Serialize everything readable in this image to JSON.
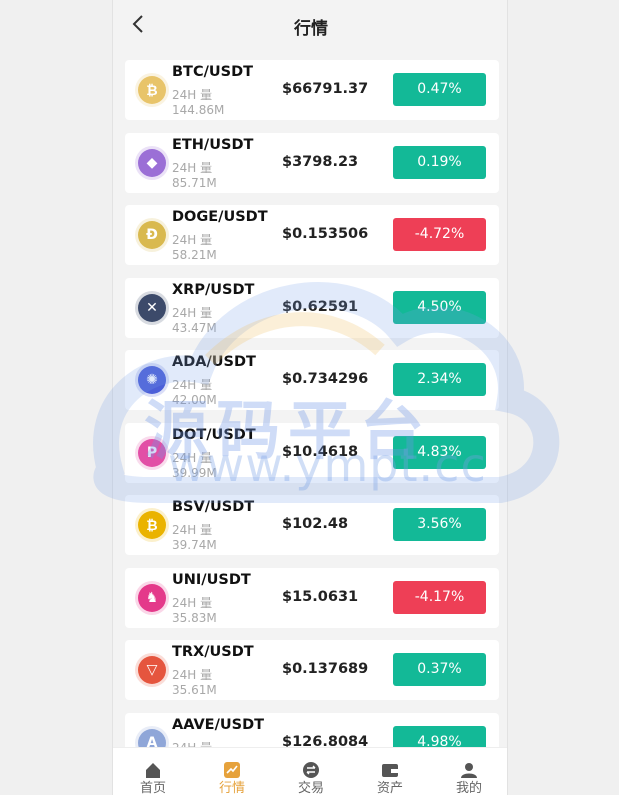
{
  "header": {
    "title": "行情"
  },
  "volume_label": "24H 量",
  "markets": [
    {
      "pair": "BTC/USDT",
      "volume": "144.86M",
      "price": "$66791.37",
      "change": "0.47%",
      "direction": "up",
      "icon": "bitcoin-icon",
      "icon_color": "#e8c46a"
    },
    {
      "pair": "ETH/USDT",
      "volume": "85.71M",
      "price": "$3798.23",
      "change": "0.19%",
      "direction": "up",
      "icon": "ethereum-icon",
      "icon_color": "#9b6fd6"
    },
    {
      "pair": "DOGE/USDT",
      "volume": "58.21M",
      "price": "$0.153506",
      "change": "-4.72%",
      "direction": "down",
      "icon": "dogecoin-icon",
      "icon_color": "#d9b94f"
    },
    {
      "pair": "XRP/USDT",
      "volume": "43.47M",
      "price": "$0.62591",
      "change": "4.50%",
      "direction": "up",
      "icon": "ripple-icon",
      "icon_color": "#3c4a6a"
    },
    {
      "pair": "ADA/USDT",
      "volume": "42.00M",
      "price": "$0.734296",
      "change": "2.34%",
      "direction": "up",
      "icon": "cardano-icon",
      "icon_color": "#4c5fd8"
    },
    {
      "pair": "DOT/USDT",
      "volume": "39.99M",
      "price": "$10.4618",
      "change": "4.83%",
      "direction": "up",
      "icon": "polkadot-icon",
      "icon_color": "#e24fa6"
    },
    {
      "pair": "BSV/USDT",
      "volume": "39.74M",
      "price": "$102.48",
      "change": "3.56%",
      "direction": "up",
      "icon": "bitcoin-sv-icon",
      "icon_color": "#eab300"
    },
    {
      "pair": "UNI/USDT",
      "volume": "35.83M",
      "price": "$15.0631",
      "change": "-4.17%",
      "direction": "down",
      "icon": "uniswap-icon",
      "icon_color": "#e4398a"
    },
    {
      "pair": "TRX/USDT",
      "volume": "35.61M",
      "price": "$0.137689",
      "change": "0.37%",
      "direction": "up",
      "icon": "tron-icon",
      "icon_color": "#e5553e"
    },
    {
      "pair": "AAVE/USDT",
      "volume": "",
      "price": "$126.8084",
      "change": "4.98%",
      "direction": "up",
      "icon": "aave-icon",
      "icon_color": "#8fa6d8"
    }
  ],
  "tabs": [
    {
      "label": "首页",
      "icon": "home-icon",
      "active": false
    },
    {
      "label": "行情",
      "icon": "chart-icon",
      "active": true
    },
    {
      "label": "交易",
      "icon": "trade-icon",
      "active": false
    },
    {
      "label": "资产",
      "icon": "wallet-icon",
      "active": false
    },
    {
      "label": "我的",
      "icon": "user-icon",
      "active": false
    }
  ],
  "watermark": {
    "cn": "源码平台",
    "url": "www.ympt.cc"
  },
  "colors": {
    "up": "#13b997",
    "down": "#ee3f56",
    "tab_active": "#e6a23c"
  }
}
